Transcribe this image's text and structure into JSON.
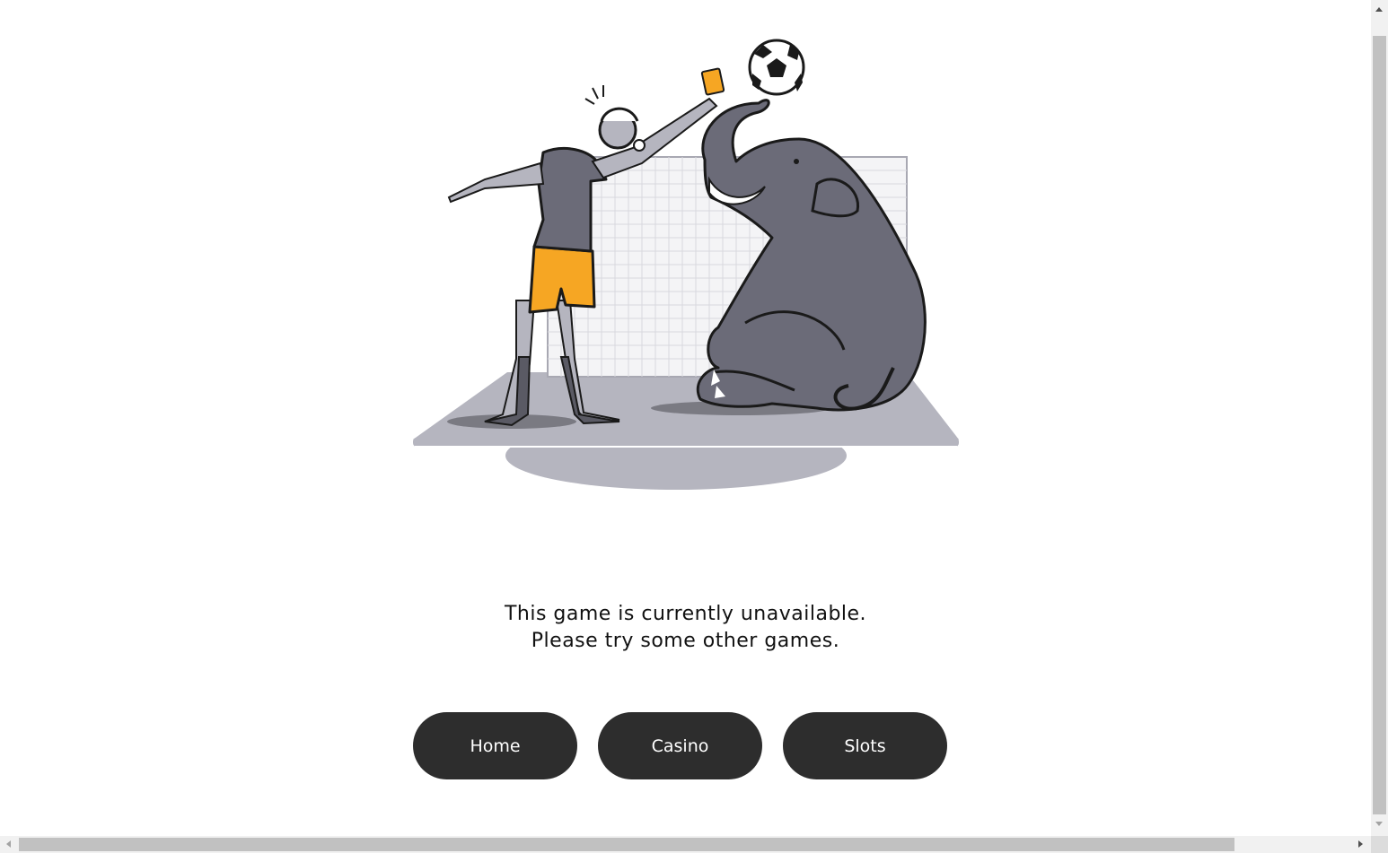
{
  "message": {
    "line1": "This game is currently unavailable.",
    "line2": "Please try some other games."
  },
  "buttons": [
    {
      "label": "Home"
    },
    {
      "label": "Casino"
    },
    {
      "label": "Slots"
    }
  ],
  "colors": {
    "button_bg": "#2d2d2d",
    "button_text": "#ffffff",
    "shorts": "#f6a623",
    "card": "#f6a623",
    "elephant": "#6b6b78",
    "pitch": "#b5b5bf"
  },
  "illustration": {
    "icons": [
      "referee-figure",
      "elephant-figure",
      "soccer-ball-icon",
      "yellow-card-icon",
      "goal-net"
    ]
  }
}
